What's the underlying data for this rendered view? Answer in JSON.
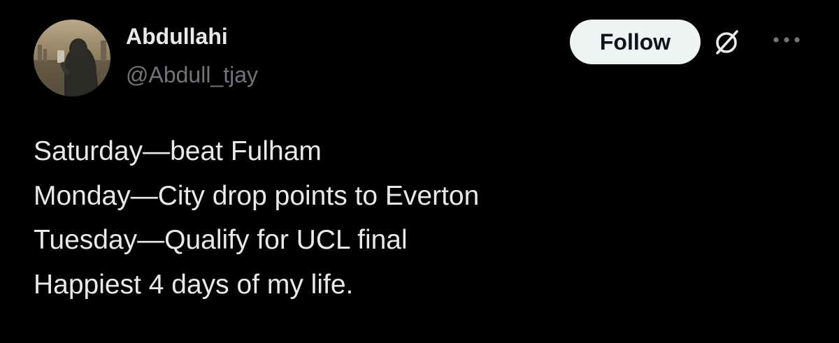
{
  "author": {
    "display_name": "Abdullahi",
    "handle": "@Abdull_tjay",
    "avatar_icon": "profile-photo-avatar"
  },
  "actions": {
    "follow_label": "Follow",
    "grok_icon": "grok-slash-circle-icon",
    "more_icon": "more-horizontal-icon"
  },
  "tweet": {
    "lines": [
      "Saturday—beat Fulham",
      "Monday—City drop points to Everton",
      "Tuesday—Qualify for UCL final",
      "Happiest 4 days of my life."
    ]
  },
  "colors": {
    "background": "#000000",
    "primary_text": "#e7e9ea",
    "secondary_text": "#71767b",
    "follow_button_bg": "#eff3f4",
    "follow_button_text": "#0f1419"
  }
}
